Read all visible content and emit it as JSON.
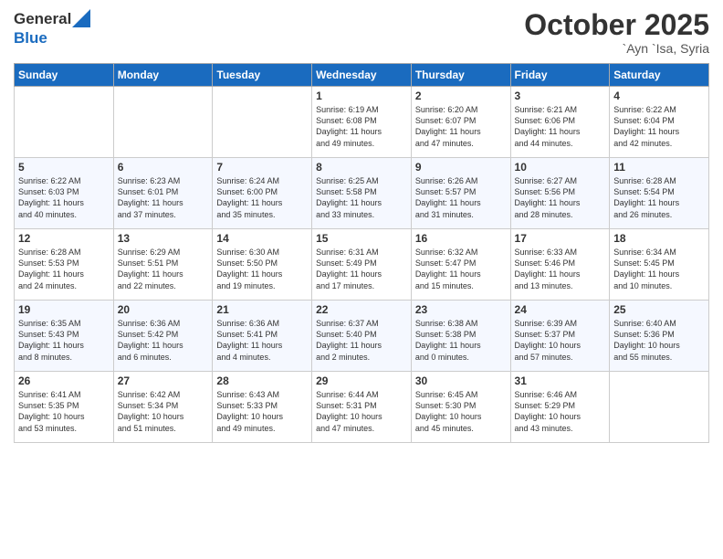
{
  "header": {
    "logo_general": "General",
    "logo_blue": "Blue",
    "month_title": "October 2025",
    "location": "`Ayn `Isa, Syria"
  },
  "weekdays": [
    "Sunday",
    "Monday",
    "Tuesday",
    "Wednesday",
    "Thursday",
    "Friday",
    "Saturday"
  ],
  "weeks": [
    [
      {
        "day": "",
        "info": ""
      },
      {
        "day": "",
        "info": ""
      },
      {
        "day": "",
        "info": ""
      },
      {
        "day": "1",
        "info": "Sunrise: 6:19 AM\nSunset: 6:08 PM\nDaylight: 11 hours\nand 49 minutes."
      },
      {
        "day": "2",
        "info": "Sunrise: 6:20 AM\nSunset: 6:07 PM\nDaylight: 11 hours\nand 47 minutes."
      },
      {
        "day": "3",
        "info": "Sunrise: 6:21 AM\nSunset: 6:06 PM\nDaylight: 11 hours\nand 44 minutes."
      },
      {
        "day": "4",
        "info": "Sunrise: 6:22 AM\nSunset: 6:04 PM\nDaylight: 11 hours\nand 42 minutes."
      }
    ],
    [
      {
        "day": "5",
        "info": "Sunrise: 6:22 AM\nSunset: 6:03 PM\nDaylight: 11 hours\nand 40 minutes."
      },
      {
        "day": "6",
        "info": "Sunrise: 6:23 AM\nSunset: 6:01 PM\nDaylight: 11 hours\nand 37 minutes."
      },
      {
        "day": "7",
        "info": "Sunrise: 6:24 AM\nSunset: 6:00 PM\nDaylight: 11 hours\nand 35 minutes."
      },
      {
        "day": "8",
        "info": "Sunrise: 6:25 AM\nSunset: 5:58 PM\nDaylight: 11 hours\nand 33 minutes."
      },
      {
        "day": "9",
        "info": "Sunrise: 6:26 AM\nSunset: 5:57 PM\nDaylight: 11 hours\nand 31 minutes."
      },
      {
        "day": "10",
        "info": "Sunrise: 6:27 AM\nSunset: 5:56 PM\nDaylight: 11 hours\nand 28 minutes."
      },
      {
        "day": "11",
        "info": "Sunrise: 6:28 AM\nSunset: 5:54 PM\nDaylight: 11 hours\nand 26 minutes."
      }
    ],
    [
      {
        "day": "12",
        "info": "Sunrise: 6:28 AM\nSunset: 5:53 PM\nDaylight: 11 hours\nand 24 minutes."
      },
      {
        "day": "13",
        "info": "Sunrise: 6:29 AM\nSunset: 5:51 PM\nDaylight: 11 hours\nand 22 minutes."
      },
      {
        "day": "14",
        "info": "Sunrise: 6:30 AM\nSunset: 5:50 PM\nDaylight: 11 hours\nand 19 minutes."
      },
      {
        "day": "15",
        "info": "Sunrise: 6:31 AM\nSunset: 5:49 PM\nDaylight: 11 hours\nand 17 minutes."
      },
      {
        "day": "16",
        "info": "Sunrise: 6:32 AM\nSunset: 5:47 PM\nDaylight: 11 hours\nand 15 minutes."
      },
      {
        "day": "17",
        "info": "Sunrise: 6:33 AM\nSunset: 5:46 PM\nDaylight: 11 hours\nand 13 minutes."
      },
      {
        "day": "18",
        "info": "Sunrise: 6:34 AM\nSunset: 5:45 PM\nDaylight: 11 hours\nand 10 minutes."
      }
    ],
    [
      {
        "day": "19",
        "info": "Sunrise: 6:35 AM\nSunset: 5:43 PM\nDaylight: 11 hours\nand 8 minutes."
      },
      {
        "day": "20",
        "info": "Sunrise: 6:36 AM\nSunset: 5:42 PM\nDaylight: 11 hours\nand 6 minutes."
      },
      {
        "day": "21",
        "info": "Sunrise: 6:36 AM\nSunset: 5:41 PM\nDaylight: 11 hours\nand 4 minutes."
      },
      {
        "day": "22",
        "info": "Sunrise: 6:37 AM\nSunset: 5:40 PM\nDaylight: 11 hours\nand 2 minutes."
      },
      {
        "day": "23",
        "info": "Sunrise: 6:38 AM\nSunset: 5:38 PM\nDaylight: 11 hours\nand 0 minutes."
      },
      {
        "day": "24",
        "info": "Sunrise: 6:39 AM\nSunset: 5:37 PM\nDaylight: 10 hours\nand 57 minutes."
      },
      {
        "day": "25",
        "info": "Sunrise: 6:40 AM\nSunset: 5:36 PM\nDaylight: 10 hours\nand 55 minutes."
      }
    ],
    [
      {
        "day": "26",
        "info": "Sunrise: 6:41 AM\nSunset: 5:35 PM\nDaylight: 10 hours\nand 53 minutes."
      },
      {
        "day": "27",
        "info": "Sunrise: 6:42 AM\nSunset: 5:34 PM\nDaylight: 10 hours\nand 51 minutes."
      },
      {
        "day": "28",
        "info": "Sunrise: 6:43 AM\nSunset: 5:33 PM\nDaylight: 10 hours\nand 49 minutes."
      },
      {
        "day": "29",
        "info": "Sunrise: 6:44 AM\nSunset: 5:31 PM\nDaylight: 10 hours\nand 47 minutes."
      },
      {
        "day": "30",
        "info": "Sunrise: 6:45 AM\nSunset: 5:30 PM\nDaylight: 10 hours\nand 45 minutes."
      },
      {
        "day": "31",
        "info": "Sunrise: 6:46 AM\nSunset: 5:29 PM\nDaylight: 10 hours\nand 43 minutes."
      },
      {
        "day": "",
        "info": ""
      }
    ]
  ]
}
